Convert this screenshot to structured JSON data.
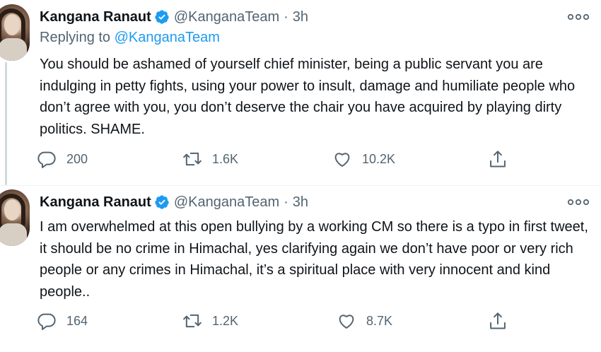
{
  "tweets": [
    {
      "name": "Kangana Ranaut",
      "handle": "@KanganaTeam",
      "separator": "·",
      "time": "3h",
      "replying_prefix": "Replying to ",
      "replying_to": "@KanganaTeam",
      "text": "You should be ashamed of yourself chief minister, being a public servant you are indulging in petty fights, using your power to insult, damage and humiliate people who don’t agree with you, you don’t deserve the chair you have acquired by playing dirty politics. SHAME.",
      "stats": {
        "replies": "200",
        "retweets": "1.6K",
        "likes": "10.2K"
      }
    },
    {
      "name": "Kangana Ranaut",
      "handle": "@KanganaTeam",
      "separator": "·",
      "time": "3h",
      "text": "I am overwhelmed at this open bullying by a working CM so there is a typo in first tweet, it should be no crime in Himachal, yes clarifying again we don’t have poor or very rich people or any crimes in Himachal, it’s a spiritual place with very innocent and kind people..",
      "stats": {
        "replies": "164",
        "retweets": "1.2K",
        "likes": "8.7K"
      }
    }
  ],
  "icons": {
    "verified": "verified-badge-icon",
    "more": "more-options-icon",
    "reply": "reply-icon",
    "retweet": "retweet-icon",
    "like": "like-icon",
    "share": "share-icon"
  },
  "colors": {
    "accent": "#1d9bf0",
    "text": "#0f1419",
    "muted": "#536471",
    "thread_line": "#cfd9de"
  }
}
